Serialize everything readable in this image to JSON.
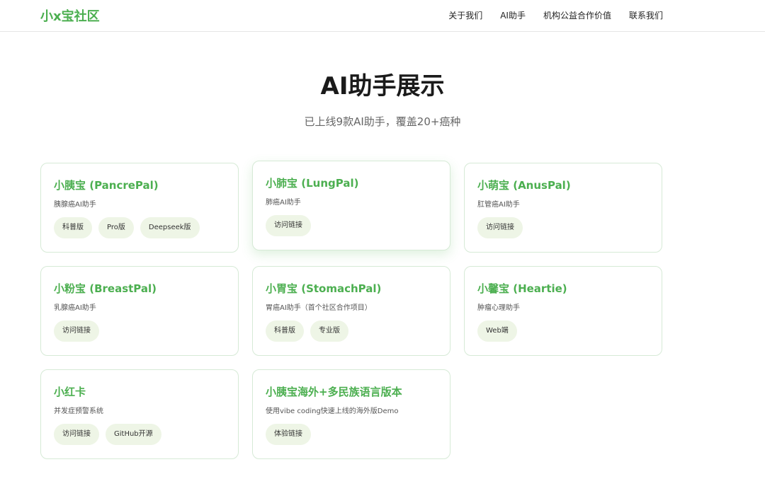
{
  "nav": {
    "logo": "小x宝社区",
    "links": [
      "关于我们",
      "AI助手",
      "机构公益合作价值",
      "联系我们"
    ]
  },
  "hero": {
    "title": "AI助手展示",
    "subtitle": "已上线9款AI助手，覆盖20+癌种"
  },
  "cards": [
    {
      "title": "小胰宝 (PancrePal)",
      "desc": "胰腺癌AI助手",
      "tags": [
        "科普版",
        "Pro版",
        "Deepseek版"
      ]
    },
    {
      "title": "小肺宝 (LungPal)",
      "desc": "肺癌AI助手",
      "tags": [
        "访问链接"
      ]
    },
    {
      "title": "小萌宝 (AnusPal)",
      "desc": "肛管癌AI助手",
      "tags": [
        "访问链接"
      ]
    },
    {
      "title": "小粉宝 (BreastPal)",
      "desc": "乳腺癌AI助手",
      "tags": [
        "访问链接"
      ]
    },
    {
      "title": "小胃宝 (StomachPal)",
      "desc": "胃癌AI助手（首个社区合作项目）",
      "tags": [
        "科普版",
        "专业版"
      ]
    },
    {
      "title": "小馨宝 (Heartie)",
      "desc": "肿瘤心理助手",
      "tags": [
        "Web端"
      ]
    },
    {
      "title": "小红卡",
      "desc": "并发症预警系统",
      "tags": [
        "访问链接",
        "GitHub开源"
      ]
    },
    {
      "title": "小胰宝海外+多民族语言版本",
      "desc": "使用vibe coding快速上线的海外版Demo",
      "tags": [
        "体验链接"
      ]
    }
  ]
}
